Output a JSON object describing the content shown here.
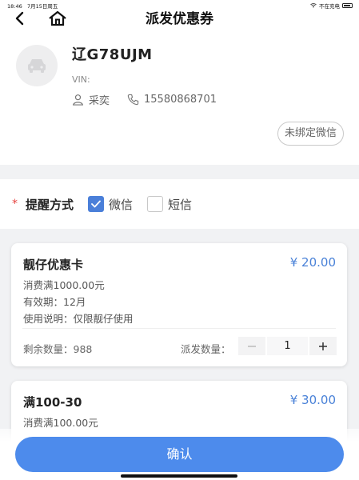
{
  "status_bar": {
    "time": "18:46",
    "date": "7月15日周五",
    "charging": "不在充电"
  },
  "nav": {
    "title": "派发优惠券"
  },
  "vehicle": {
    "plate": "辽G78UJM",
    "vin_label": "VIN:",
    "owner_name": "采奕",
    "phone": "15580868701",
    "unbind_label": "未绑定微信"
  },
  "remind": {
    "required_mark": "*",
    "label": "提醒方式",
    "options": [
      {
        "label": "微信",
        "checked": true
      },
      {
        "label": "短信",
        "checked": false
      }
    ]
  },
  "coupons": [
    {
      "name": "靓仔优惠卡",
      "price": "¥ 20.00",
      "condition": "消费满1000.00元",
      "validity": "有效期：12月",
      "usage": "使用说明：仅限靓仔使用",
      "remaining": "剩余数量：988",
      "dist_label": "派发数量：",
      "quantity": "1"
    },
    {
      "name": "满100-30",
      "price": "¥ 30.00",
      "condition": "消费满100.00元"
    }
  ],
  "confirm_label": "确认",
  "colors": {
    "accent": "#4d8bec",
    "price": "#4a82d8",
    "required": "#e64340"
  }
}
